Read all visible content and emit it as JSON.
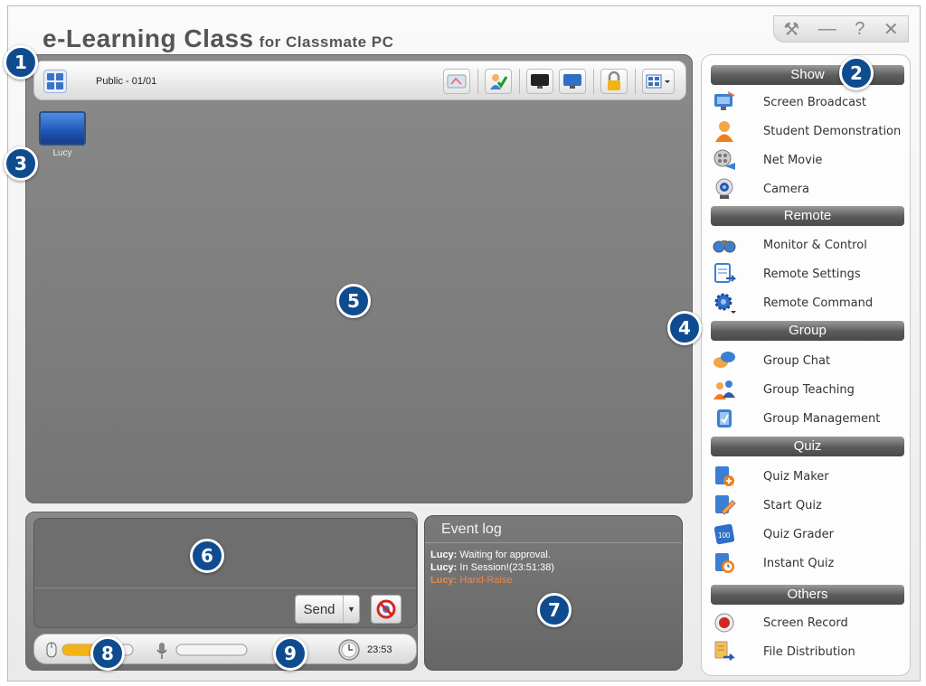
{
  "app": {
    "title": "e-Learning Class",
    "subtitle": "for Classmate PC",
    "window_controls": [
      "⚒",
      "—",
      "?",
      "✕"
    ]
  },
  "toolbar": {
    "class_label": "Public - 01/01"
  },
  "students": [
    {
      "name": "Lucy"
    }
  ],
  "chat": {
    "send_label": "Send"
  },
  "status": {
    "time": "23:53"
  },
  "event_log": {
    "title": "Event log",
    "entries": [
      {
        "user": "Lucy:",
        "text": "Waiting for approval."
      },
      {
        "user": "Lucy:",
        "text": "In Session!(23:51:38)"
      },
      {
        "user": "Lucy:",
        "text": "Hand-Raise"
      }
    ]
  },
  "sidebar": {
    "sections": [
      {
        "title": "Show",
        "items": [
          "Screen Broadcast",
          "Student Demonstration",
          "Net Movie",
          "Camera"
        ]
      },
      {
        "title": "Remote",
        "items": [
          "Monitor & Control",
          "Remote Settings",
          "Remote Command"
        ]
      },
      {
        "title": "Group",
        "items": [
          "Group Chat",
          "Group Teaching",
          "Group Management"
        ]
      },
      {
        "title": "Quiz",
        "items": [
          "Quiz Maker",
          "Start Quiz",
          "Quiz Grader",
          "Instant Quiz"
        ]
      },
      {
        "title": "Others",
        "items": [
          "Screen Record",
          "File Distribution"
        ]
      }
    ]
  },
  "callouts": [
    "1",
    "2",
    "3",
    "4",
    "5",
    "6",
    "7",
    "8",
    "9"
  ],
  "colors": {
    "callout": "#0f4c8f",
    "hand_raise": "#e7894c"
  }
}
